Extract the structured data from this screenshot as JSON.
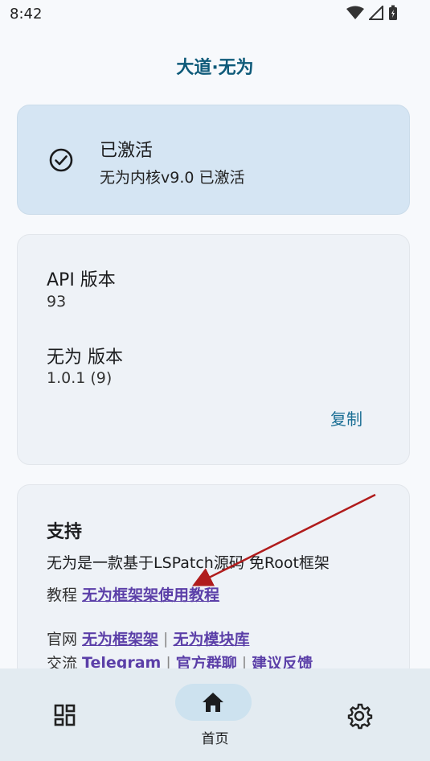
{
  "status_bar": {
    "time": "8:42"
  },
  "app_title": "大道·无为",
  "status_card": {
    "title": "已激活",
    "subtitle": "无为内核v9.0 已激活"
  },
  "info_card": {
    "api_label": "API 版本",
    "api_value": "93",
    "app_label": "无为 版本",
    "app_value": "1.0.1 (9)",
    "copy_label": "复制"
  },
  "support_card": {
    "title": "支持",
    "description": "无为是一款基于LSPatch源码 免Root框架",
    "tutorial_prefix": "教程",
    "tutorial_link": "无为框架架使用教程",
    "website_prefix": "官网",
    "website_link_1": "无为框架架",
    "website_link_2": "无为模块库",
    "community_prefix": "交流",
    "community_link_1": "Telegram",
    "community_link_2": "官方群聊",
    "community_link_3": "建议反馈"
  },
  "bottom_nav": {
    "home_label": "首页"
  },
  "colors": {
    "accent": "#0e5a79",
    "link": "#5b3fa8",
    "status_card_bg": "#d5e5f3",
    "arrow": "#b01c1c"
  },
  "icons": [
    "wifi-icon",
    "signal-icon",
    "battery-icon",
    "check-circle-icon",
    "grid-icon",
    "home-icon",
    "gear-icon"
  ]
}
